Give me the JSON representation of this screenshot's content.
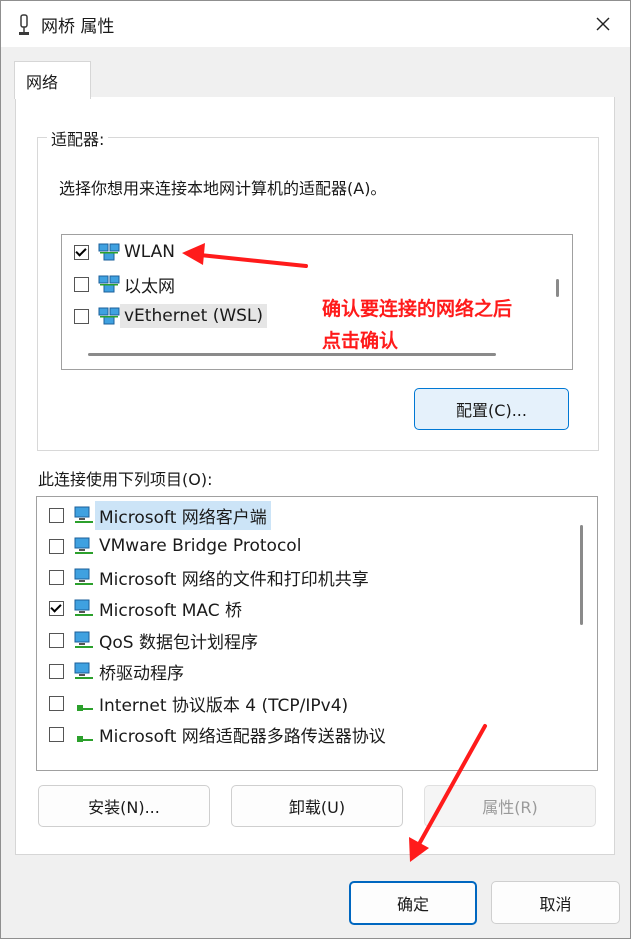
{
  "window": {
    "title": "网桥 属性",
    "close_glyph": "✕"
  },
  "tabs": [
    {
      "label": "网络"
    }
  ],
  "adapters": {
    "group_label": "适配器:",
    "description": "选择你想用来连接本地网计算机的适配器(A)。",
    "items": [
      {
        "label": "WLAN",
        "checked": true
      },
      {
        "label": "以太网",
        "checked": false
      },
      {
        "label": "vEthernet (WSL)",
        "checked": false
      }
    ],
    "configure_button": "配置(C)..."
  },
  "components": {
    "label": "此连接使用下列项目(O):",
    "items": [
      {
        "label": "Microsoft 网络客户端",
        "checked": false,
        "icon": "network-client-icon"
      },
      {
        "label": "VMware Bridge Protocol",
        "checked": false,
        "icon": "network-protocol-icon"
      },
      {
        "label": "Microsoft 网络的文件和打印机共享",
        "checked": false,
        "icon": "network-service-icon"
      },
      {
        "label": "Microsoft MAC 桥",
        "checked": true,
        "icon": "network-protocol-icon"
      },
      {
        "label": "QoS 数据包计划程序",
        "checked": false,
        "icon": "network-service-icon"
      },
      {
        "label": "桥驱动程序",
        "checked": false,
        "icon": "network-protocol-icon"
      },
      {
        "label": "Internet 协议版本 4 (TCP/IPv4)",
        "checked": false,
        "icon": "protocol-icon"
      },
      {
        "label": "Microsoft 网络适配器多路传送器协议",
        "checked": false,
        "icon": "protocol-icon"
      }
    ]
  },
  "buttons": {
    "install": "安装(N)...",
    "uninstall": "卸载(U)",
    "properties": "属性(R)",
    "ok": "确定",
    "cancel": "取消"
  },
  "annotation": {
    "line1": "确认要连接的网络之后",
    "line2": "点击确认",
    "color": "#ff1b1b"
  }
}
